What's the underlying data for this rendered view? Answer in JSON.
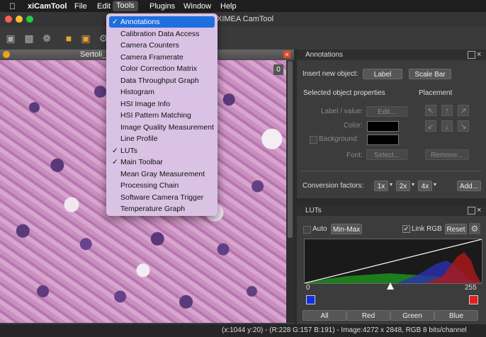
{
  "menubar": {
    "app_name": "xiCamTool",
    "items": [
      "File",
      "Edit",
      "Tools",
      "Plugins",
      "Window",
      "Help"
    ]
  },
  "window": {
    "title": "XIMEA CamTool"
  },
  "image_window": {
    "title": "Sertoli_c",
    "counter": "0"
  },
  "tools_menu": {
    "items": [
      {
        "label": "Annotations",
        "checked": true,
        "highlighted": true
      },
      {
        "label": "Calibration Data Access",
        "checked": false
      },
      {
        "label": "Camera Counters",
        "checked": false
      },
      {
        "label": "Camera Framerate",
        "checked": false
      },
      {
        "label": "Color Correction Matrix",
        "checked": false
      },
      {
        "label": "Data Throughput Graph",
        "checked": false
      },
      {
        "label": "Histogram",
        "checked": false
      },
      {
        "label": "HSI Image Info",
        "checked": false
      },
      {
        "label": "HSI Pattern Matching",
        "checked": false
      },
      {
        "label": "Image Quality Measurement",
        "checked": false
      },
      {
        "label": "Line Profile",
        "checked": false
      },
      {
        "label": "LUTs",
        "checked": true
      },
      {
        "label": "Main Toolbar",
        "checked": true
      },
      {
        "label": "Mean Gray Measurement",
        "checked": false
      },
      {
        "label": "Processing Chain",
        "checked": false
      },
      {
        "label": "Software Camera Trigger",
        "checked": false
      },
      {
        "label": "Temperature Graph",
        "checked": false
      }
    ]
  },
  "annotations": {
    "title": "Annotations",
    "insert_label": "Insert new object:",
    "label_button": "Label",
    "scalebar_button": "Scale Bar",
    "props_heading": "Selected object properties",
    "placement_heading": "Placement",
    "label_value": "Label / value:",
    "edit_button": "Edit...",
    "color": "Color:",
    "background": "Background:",
    "font": "Font:",
    "select_button": "Select...",
    "remove_button": "Remove...",
    "conversion": "Conversion factors:",
    "factors": [
      "1x",
      "2x",
      "4x"
    ],
    "add_button": "Add..."
  },
  "luts": {
    "title": "LUTs",
    "auto": "Auto",
    "minmax_button": "Min-Max",
    "link_rgb": "Link RGB",
    "reset_button": "Reset",
    "axis_min": "0",
    "axis_max": "255",
    "channel_tabs": [
      "All",
      "Red",
      "Green",
      "Blue"
    ]
  },
  "status": {
    "text": "(x:1044 y:20) - (R:228 G:157 B:191) - Image:4272 x 2848, RGB 8 bits/channel"
  },
  "colors": {
    "accent": "#1f6ee0",
    "menu_bg": "#d9c2e4",
    "lut_red": "#e02020",
    "lut_blue": "#1030e0"
  }
}
